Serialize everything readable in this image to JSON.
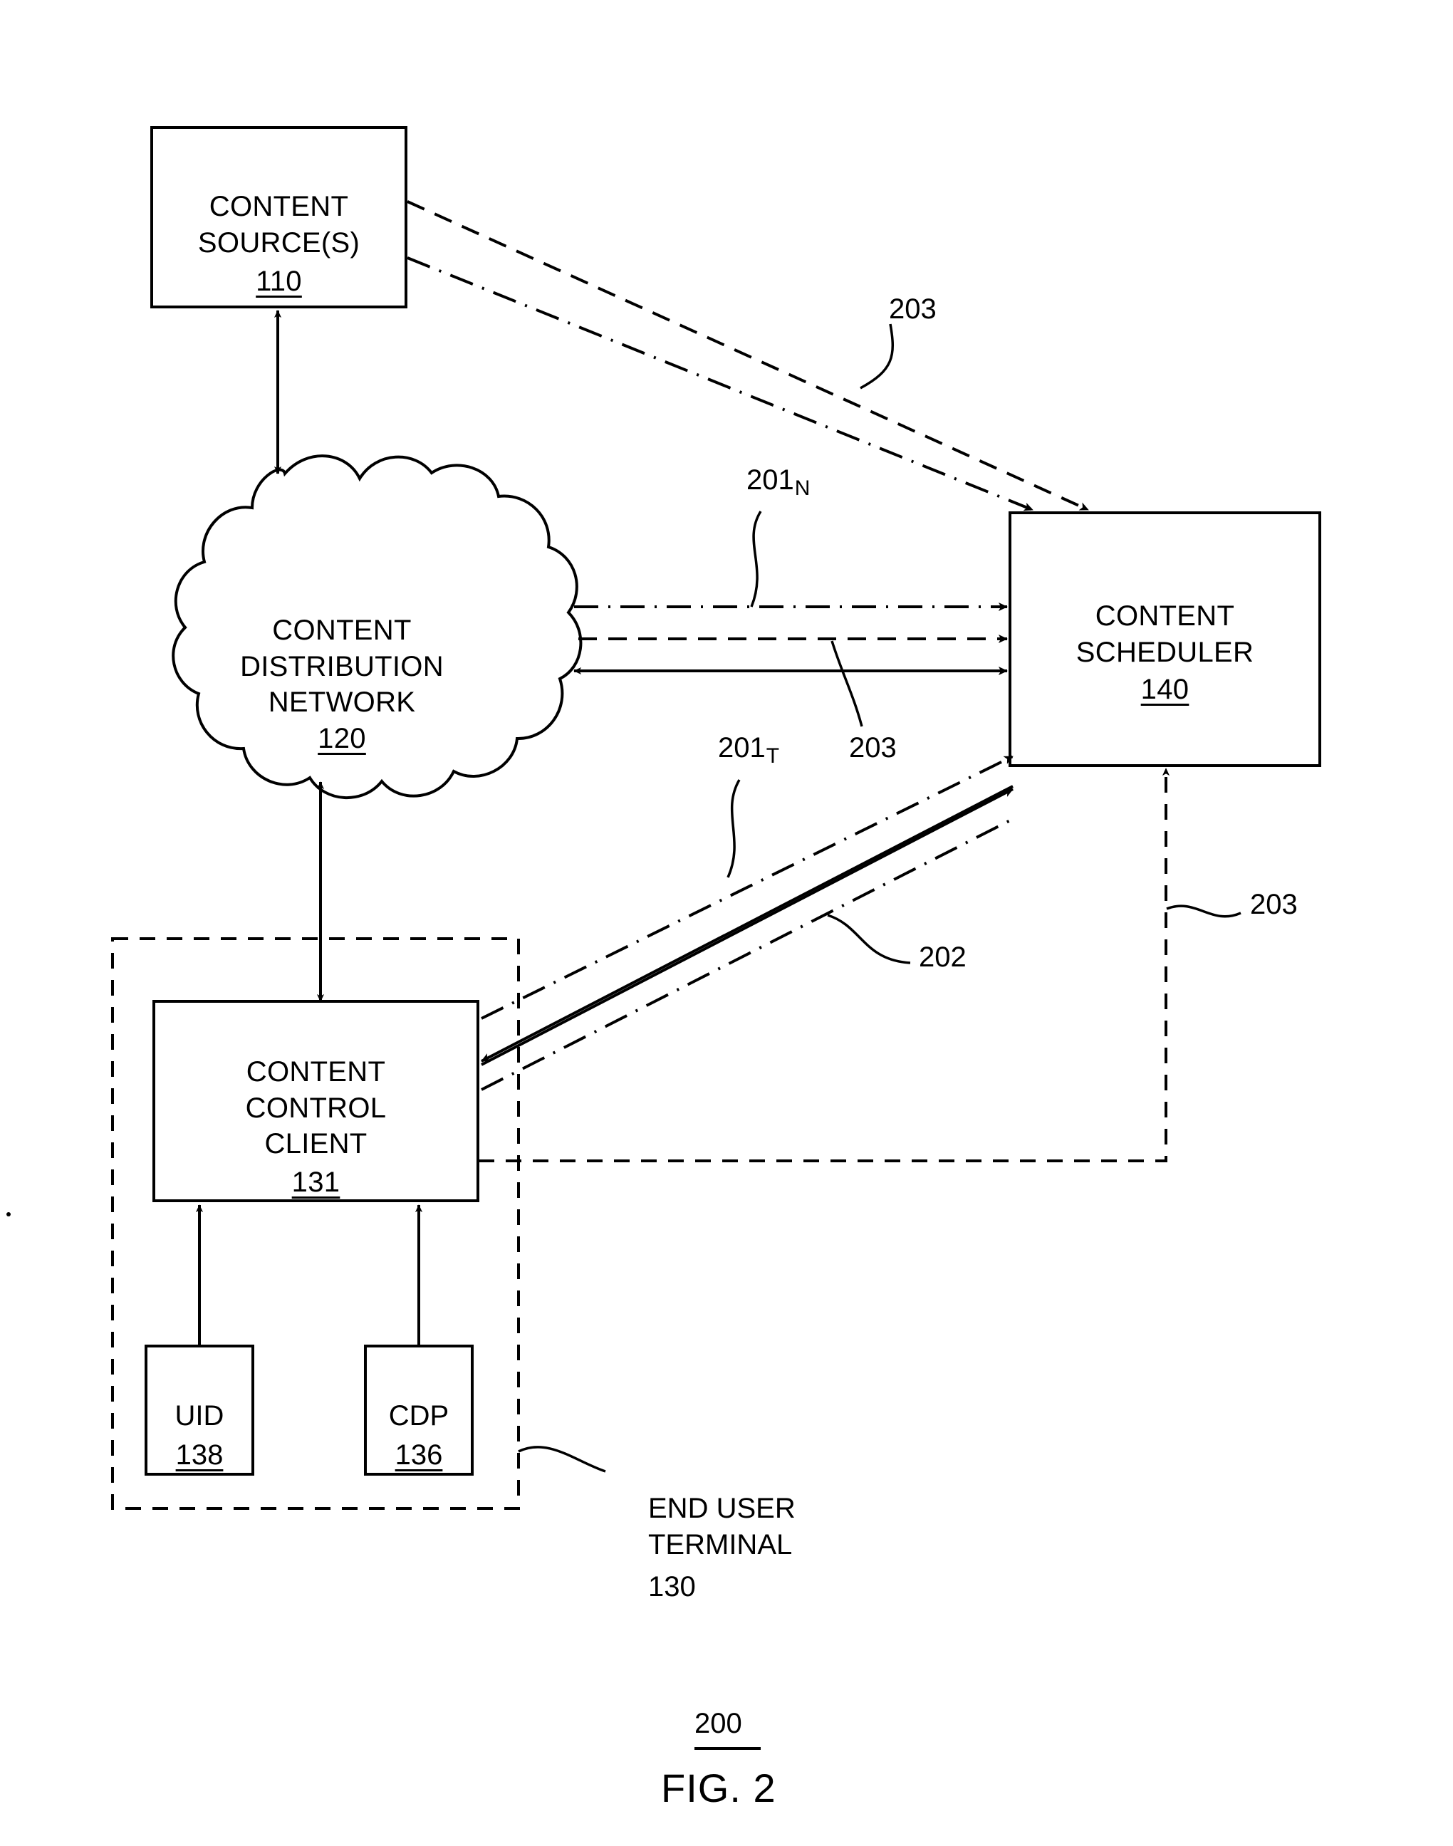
{
  "figure": {
    "caption": "FIG. 2",
    "figure_reference": "200"
  },
  "nodes": {
    "content_source": {
      "title": "CONTENT\nSOURCE(S)",
      "ref": "110",
      "shape": "rectangle"
    },
    "content_distribution_network": {
      "title": "CONTENT\nDISTRIBUTION\nNETWORK",
      "ref": "120",
      "shape": "cloud"
    },
    "content_scheduler": {
      "title": "CONTENT\nSCHEDULER",
      "ref": "140",
      "shape": "rectangle"
    },
    "content_control_client": {
      "title": "CONTENT\nCONTROL\nCLIENT",
      "ref": "131",
      "shape": "rectangle"
    },
    "uid": {
      "title": "UID",
      "ref": "138",
      "shape": "rectangle"
    },
    "cdp": {
      "title": "CDP",
      "ref": "136",
      "shape": "rectangle"
    },
    "end_user_terminal": {
      "title": "END USER\nTERMINAL",
      "ref": "130",
      "shape": "dashed-container"
    }
  },
  "annotations": {
    "source_to_scheduler_203": "203",
    "network_path_201n": "201",
    "network_path_201n_sub": "N",
    "terminal_path_201t": "201",
    "terminal_path_201t_sub": "T",
    "middle_203": "203",
    "solid_path_202": "202",
    "vertical_203": "203"
  },
  "colors": {
    "stroke": "#000000",
    "background": "#ffffff"
  }
}
